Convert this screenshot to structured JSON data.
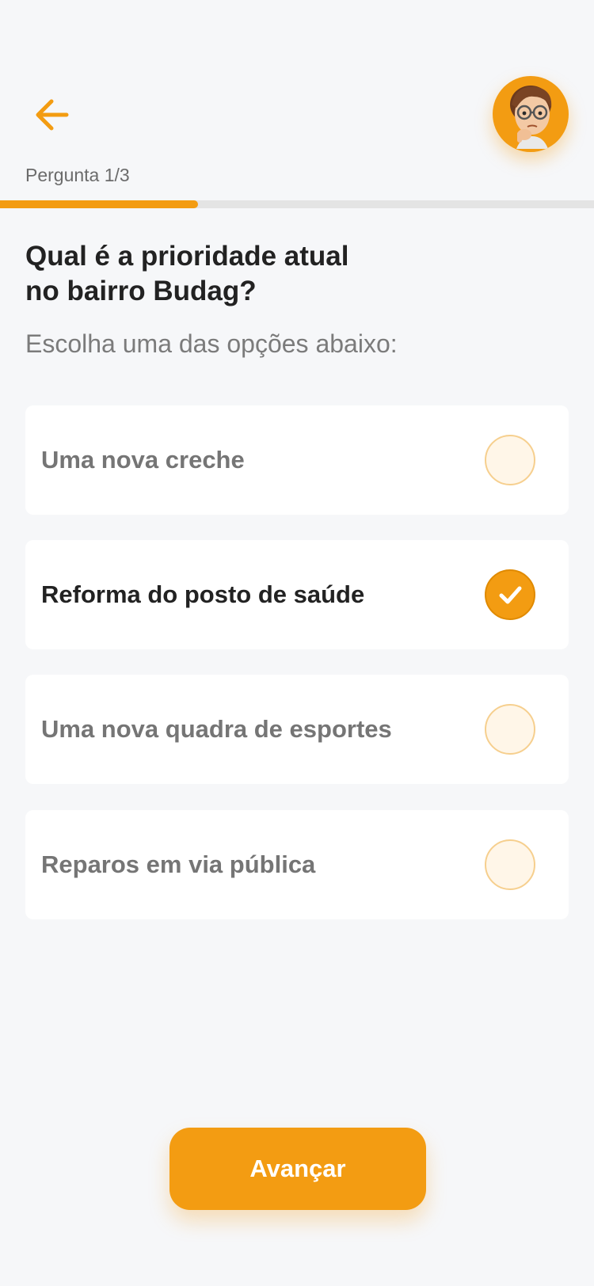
{
  "header": {
    "back_icon": "arrow-left-icon",
    "avatar_icon": "thinking-avatar"
  },
  "progress": {
    "label": "Pergunta 1/3",
    "fraction": 0.333
  },
  "question": {
    "title_line1": "Qual é a prioridade atual",
    "title_line2": "no bairro Budag?",
    "subtitle": "Escolha uma das opções abaixo:"
  },
  "options": [
    {
      "label": "Uma nova creche",
      "selected": false
    },
    {
      "label": "Reforma do posto de saúde",
      "selected": true
    },
    {
      "label": "Uma nova quadra de esportes",
      "selected": false
    },
    {
      "label": "Reparos em via pública",
      "selected": false
    }
  ],
  "actions": {
    "next_label": "Avançar"
  },
  "colors": {
    "accent": "#f39c12",
    "background": "#f6f7f9",
    "card": "#ffffff"
  }
}
